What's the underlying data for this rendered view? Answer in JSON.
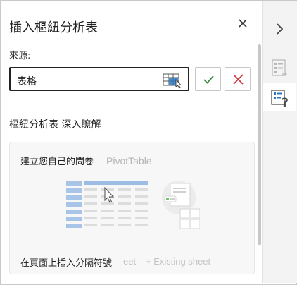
{
  "pane": {
    "title": "插入樞紐分析表",
    "source_label": "來源:",
    "source_value": "表格",
    "insights_title": "樞紐分析表 深入瞭解",
    "card": {
      "line1": "建立您自己的問卷",
      "line1_ghost": "PivotTable",
      "line2": "在頁面上插入分隔符號",
      "line2_ghost_a": "eet",
      "line2_ghost_b": "+ Existing sheet"
    }
  },
  "icons": {
    "close": "close-icon",
    "range_picker": "table-select-icon",
    "ok": "checkmark-icon",
    "cancel": "x-icon",
    "collapse": "chevron-right-icon",
    "fields": "field-list-icon",
    "help": "pivot-help-icon"
  },
  "colors": {
    "ok_check": "#3a8a3a",
    "cancel_x": "#d13438",
    "accent_blue": "#2b78c2"
  }
}
